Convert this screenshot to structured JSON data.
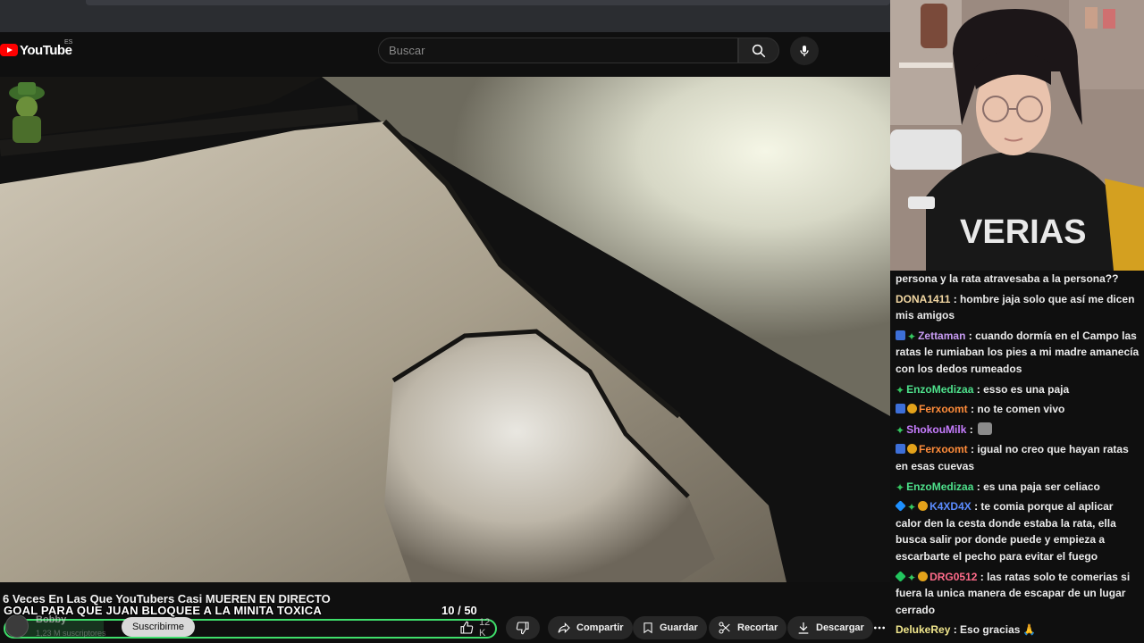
{
  "youtube": {
    "brand": "YouTube",
    "region": "ES",
    "search_placeholder": "Buscar",
    "video_title": "6 Veces En Las Que YouTubers Casi MUEREN EN DIRECTO",
    "channel_name": "Bobby",
    "subscribers": "1,23 M suscriptores",
    "subscribe_label": "Suscribirme",
    "likes": "12 K",
    "actions": {
      "share": "Compartir",
      "save": "Guardar",
      "clip": "Recortar",
      "download": "Descargar"
    }
  },
  "goal": {
    "text": "GOAL PARA QUE JUAN BLOQUEE A LA MINITA TOXICA",
    "current": "10",
    "target": "50",
    "progress": 0.2,
    "bar_color": "#3fdf6b"
  },
  "chat": {
    "messages": [
      {
        "badges": [],
        "user": "",
        "user_color": "#ffffff",
        "text": "persona y la rata atravesaba a la persona??"
      },
      {
        "badges": [],
        "user": "DONA1411",
        "user_color": "#f2d7a2",
        "text": "hombre jaja solo que así me dicen mis amigos"
      },
      {
        "badges": [
          "blue",
          "green"
        ],
        "user": "Zettaman",
        "user_color": "#c79bf2",
        "text": "cuando dormía en el Campo las ratas le rumiaban los pies a mi madre amanecía con los dedos rumeados"
      },
      {
        "badges": [
          "green"
        ],
        "user": "EnzoMedizaa",
        "user_color": "#4ee08b",
        "text": "esso es una paja"
      },
      {
        "badges": [
          "blue",
          "gold"
        ],
        "user": "Ferxoomt",
        "user_color": "#ff8c3a",
        "text": "no te comen vivo"
      },
      {
        "badges": [
          "green"
        ],
        "user": "ShokouMilk",
        "user_color": "#c77dff",
        "text": "",
        "emote": true
      },
      {
        "badges": [
          "blue",
          "gold"
        ],
        "user": "Ferxoomt",
        "user_color": "#ff8c3a",
        "text": "igual no creo que hayan ratas en esas cuevas"
      },
      {
        "badges": [
          "green"
        ],
        "user": "EnzoMedizaa",
        "user_color": "#4ee08b",
        "text": "es una paja ser celiaco"
      },
      {
        "badges": [
          "cube",
          "green",
          "gold"
        ],
        "user": "K4XD4X",
        "user_color": "#5b8cff",
        "text": "te comia porque al aplicar calor den la cesta donde estaba la rata, ella busca salir por donde puede y empieza a escarbarte el pecho para evitar el fuego"
      },
      {
        "badges": [
          "cubeg",
          "green",
          "gold"
        ],
        "user": "DRG0512",
        "user_color": "#ff6b8a",
        "text": "las ratas solo te comerias si fuera la unica manera de escapar de un lugar cerrado"
      },
      {
        "badges": [],
        "user": "DelukeRey",
        "user_color": "#f0e68c",
        "text": "Eso gracias",
        "emoji": "🙏"
      }
    ]
  },
  "colors": {
    "youtube_red": "#ff0000",
    "background": "#0f0f0f",
    "button_bg": "#272727"
  }
}
